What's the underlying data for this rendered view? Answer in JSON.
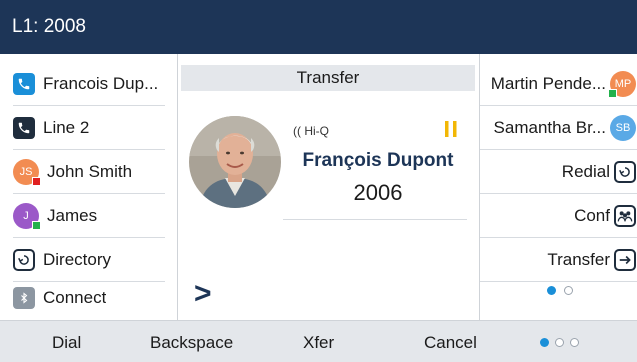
{
  "status_bar": {
    "line_label": "L1: 2008"
  },
  "left_keys": [
    {
      "label": "Francois Dup...",
      "icon": "phone-icon"
    },
    {
      "label": "Line 2",
      "icon": "phone-icon"
    },
    {
      "label": "John Smith",
      "initials": "JS",
      "avatar_color": "#f28c52",
      "presence_color": "#e02020"
    },
    {
      "label": "James",
      "initials": "J",
      "avatar_color": "#9b59c8",
      "presence_color": "#22b14c"
    },
    {
      "label": "Directory",
      "icon": "directory-icon"
    },
    {
      "label": "Connect",
      "icon": "bluetooth-icon"
    }
  ],
  "call": {
    "title": "Transfer",
    "hiq_label": "Hi-Q",
    "caller_name": "François Dupont",
    "caller_number": "2006",
    "prompt": ">"
  },
  "right_keys": [
    {
      "label": "Martin Pende...",
      "initials": "MP",
      "avatar_color": "#f28c52",
      "presence_color": "#22b14c"
    },
    {
      "label": "Samantha Br...",
      "initials": "SB",
      "avatar_color": "#5aa9e6"
    },
    {
      "label": "Redial",
      "icon": "redial-icon"
    },
    {
      "label": "Conf",
      "icon": "conference-icon"
    },
    {
      "label": "Transfer",
      "icon": "transfer-icon"
    }
  ],
  "right_page_indicator": {
    "pages": 2,
    "current": 1
  },
  "softkeys": [
    {
      "label": "Dial"
    },
    {
      "label": "Backspace"
    },
    {
      "label": "Xfer"
    },
    {
      "label": "Cancel"
    }
  ],
  "softkey_page_indicator": {
    "pages": 3,
    "current": 1
  },
  "colors": {
    "header": "#1d3557",
    "accent": "#1a8fd8",
    "hold": "#f2b705"
  }
}
